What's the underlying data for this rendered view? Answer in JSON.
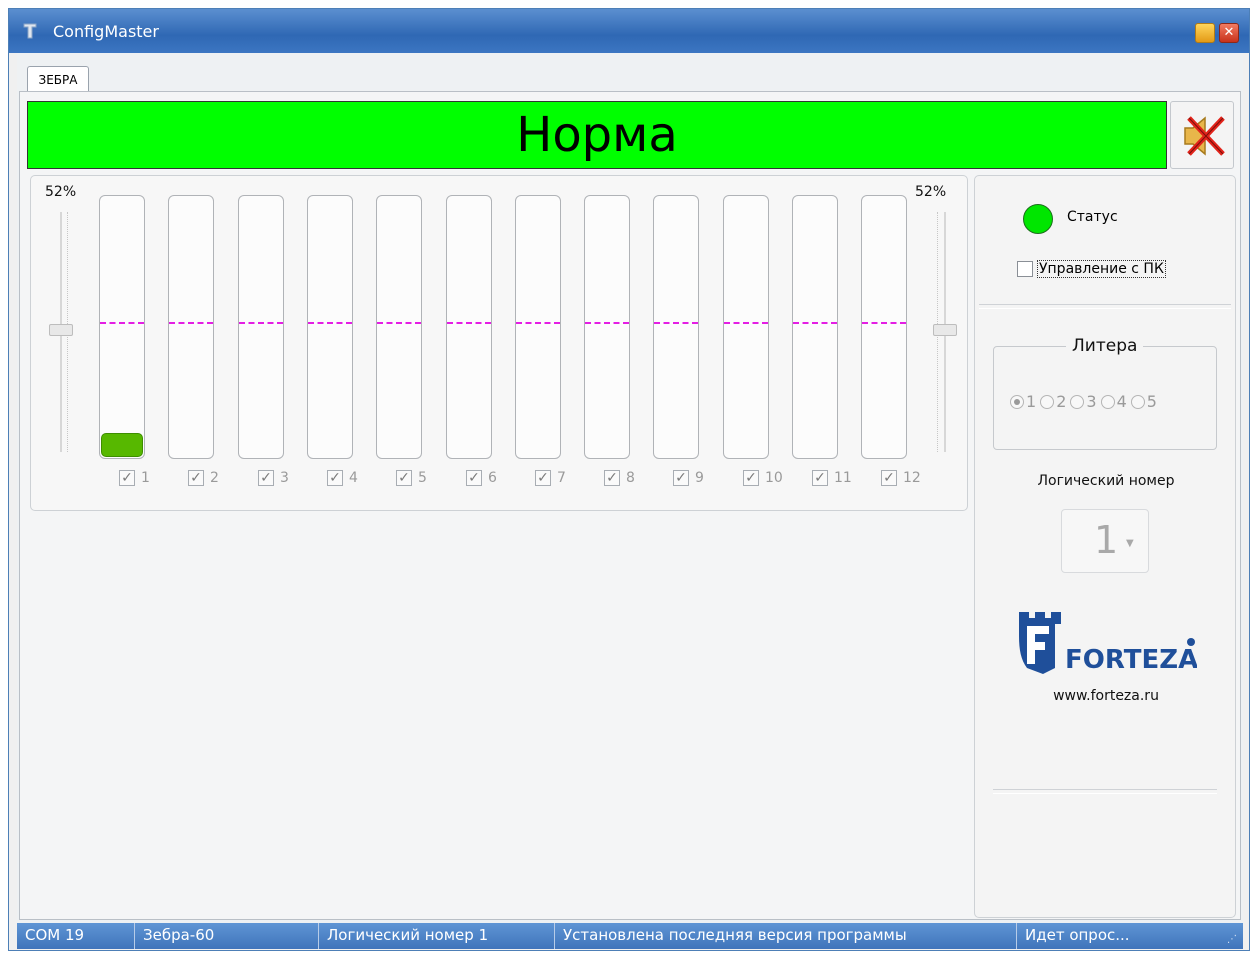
{
  "window": {
    "title": "ConfigMaster"
  },
  "tabs": [
    {
      "label": "ЗЕБРА"
    }
  ],
  "banner": {
    "text": "Норма",
    "color": "#00ff00"
  },
  "chart": {
    "left_pct": "52%",
    "right_pct": "52%",
    "threshold_color": "#e41ee4",
    "fill_color": "#57b800"
  },
  "chart_data": {
    "type": "bar",
    "categories": [
      "1",
      "2",
      "3",
      "4",
      "5",
      "6",
      "7",
      "8",
      "9",
      "10",
      "11",
      "12"
    ],
    "values": [
      0.09,
      0,
      0,
      0,
      0,
      0,
      0,
      0,
      0,
      0,
      0,
      0
    ],
    "threshold": 0.52,
    "checked": [
      true,
      true,
      true,
      true,
      true,
      true,
      true,
      true,
      true,
      true,
      true,
      true
    ]
  },
  "right": {
    "status_label": "Статус",
    "status_color": "#00e600",
    "pc_control_label": "Управление с ПК",
    "pc_control_checked": false,
    "litera_title": "Литера",
    "litera_options": [
      "1",
      "2",
      "3",
      "4",
      "5"
    ],
    "litera_selected": "1",
    "logical_number_label": "Логический номер",
    "logical_number_value": "1",
    "logo_text": "FORTEZA",
    "logo_url": "www.forteza.ru"
  },
  "statusbar": {
    "port": "COM 19",
    "device": "Зебра-60",
    "logical": "Логический номер 1",
    "version": "Установлена последняя версия программы",
    "poll": "Идет опрос..."
  }
}
